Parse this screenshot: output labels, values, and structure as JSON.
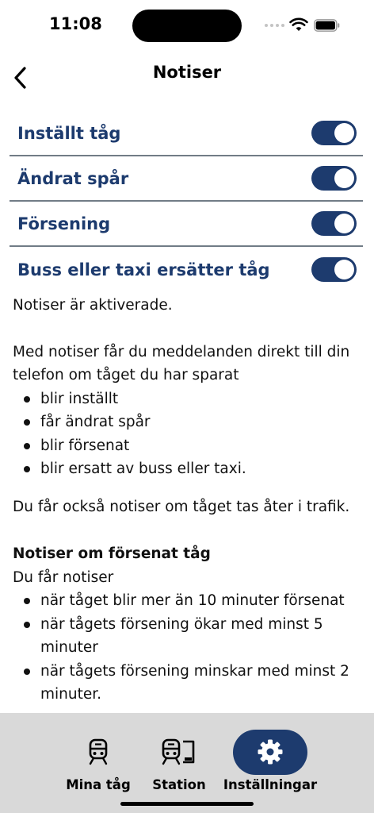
{
  "status_bar": {
    "time": "11:08"
  },
  "header": {
    "title": "Notiser"
  },
  "toggles": [
    {
      "label": "Inställt tåg",
      "on": true
    },
    {
      "label": "Ändrat spår",
      "on": true
    },
    {
      "label": "Försening",
      "on": true
    },
    {
      "label": "Buss eller taxi ersätter tåg",
      "on": true
    }
  ],
  "content": {
    "status_text": "Notiser är aktiverade.",
    "intro": "Med notiser får du meddelanden direkt till din telefon om tåget du har sparat",
    "intro_items": [
      "blir inställt",
      "får ändrat spår",
      "blir försenat",
      "blir ersatt av buss eller taxi."
    ],
    "reinstated": "Du får också notiser om tåget tas åter i trafik.",
    "delay_heading": "Notiser om försenat tåg",
    "delay_intro": "Du får notiser",
    "delay_items": [
      "när tåget blir mer än 10 minuter försenat",
      "när tågets försening ökar med minst 5 minuter",
      "när tågets försening minskar med minst 2 minuter."
    ]
  },
  "tab_bar": {
    "tabs": [
      {
        "label": "Mina tåg",
        "icon": "train-icon",
        "active": false
      },
      {
        "label": "Station",
        "icon": "station-icon",
        "active": false
      },
      {
        "label": "Inställningar",
        "icon": "gear-icon",
        "active": true
      }
    ]
  },
  "colors": {
    "accent": "#1d3b6e",
    "divider": "#717c86",
    "tab_bar_bg": "#d9d9d9"
  }
}
